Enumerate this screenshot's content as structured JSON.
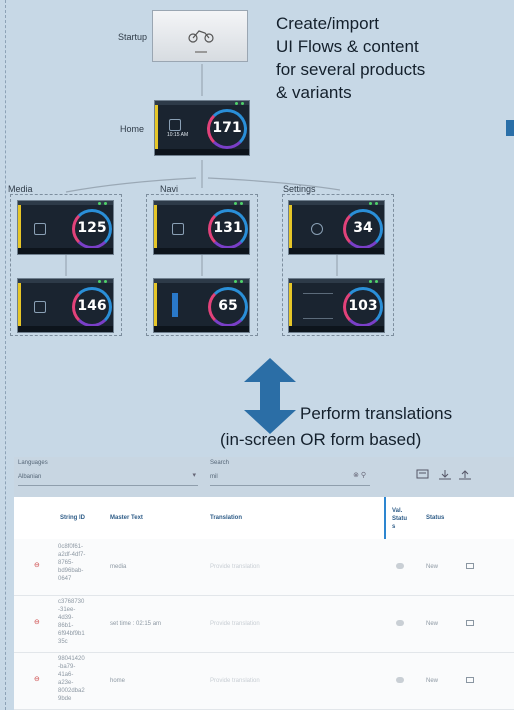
{
  "flow": {
    "startup": {
      "label": "Startup"
    },
    "home": {
      "label": "Home",
      "speed": "171",
      "time": "10:15 AM"
    },
    "groups": [
      {
        "label": "Media",
        "speeds": [
          "125",
          "146"
        ]
      },
      {
        "label": "Navi",
        "speeds": [
          "131",
          "65"
        ]
      },
      {
        "label": "Settings",
        "speeds": [
          "34",
          "103"
        ]
      }
    ]
  },
  "captions": {
    "top": "Create/import\nUI Flows & content\nfor several products\n& variants",
    "bottom_line1": "Perform translations",
    "bottom_line2": "(in-screen OR form based)"
  },
  "translation_form": {
    "languages_label": "Languages",
    "language_value": "Albanian",
    "search_label": "Search",
    "search_value": "mil",
    "columns": [
      "String ID",
      "Master Text",
      "Translation",
      "Val. Statu s",
      "Status"
    ],
    "rows": [
      {
        "string_id": "0c8f0f61-\na2df-4df7-\n8765-\nbd96bab-\n0647",
        "master_text": "media",
        "translation_placeholder": "Provide translation",
        "status": "New"
      },
      {
        "string_id": "c3768730\n-31ee-\n4d39-\n86b1-\n6f94bf9b1\n35c",
        "master_text": "set time : 02:15 am",
        "translation_placeholder": "Provide translation",
        "status": "New"
      },
      {
        "string_id": "98041420\n-ba79-\n41a6-\na23e-\n8002dba2\n9bde",
        "master_text": "home",
        "translation_placeholder": "Provide translation",
        "status": "New"
      }
    ]
  },
  "icons": [
    "motorcycle-icon",
    "chevron-down-icon",
    "search-icon",
    "screen-view-icon",
    "download-icon",
    "upload-icon",
    "delete-icon",
    "comment-icon"
  ],
  "colors": {
    "background": "#c7d8e6",
    "accent": "#2a6fa8",
    "table_divider": "#2d86d0"
  }
}
